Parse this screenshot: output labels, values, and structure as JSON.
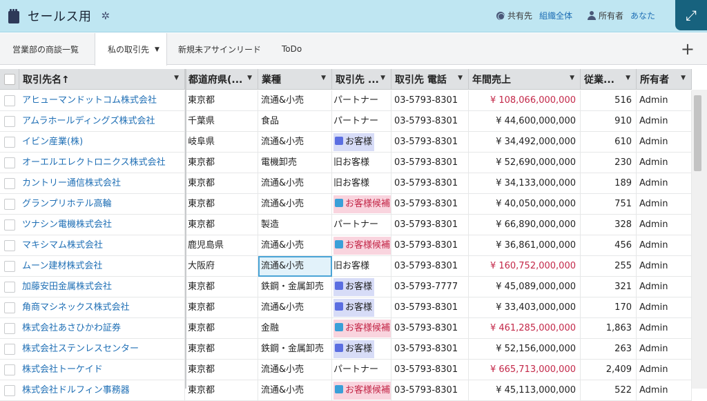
{
  "header": {
    "title": "セールス用",
    "shared_label": "共有先",
    "shared_value": "組織全体",
    "owner_label": "所有者",
    "owner_value": "あなた",
    "colors": {
      "bg": "#bfe6f2",
      "accent": "#17627e",
      "link": "#1f6fb5"
    }
  },
  "icons": {
    "sheet": "document-icon",
    "gear": "gear-icon",
    "globe": "globe-icon",
    "user": "user-icon",
    "expand": "expand-icon",
    "add": "plus-icon"
  },
  "tabs": [
    {
      "label": "営業部の商談一覧",
      "active": false
    },
    {
      "label": "私の取引先",
      "active": true
    },
    {
      "label": "新規未アサインリード",
      "active": false
    },
    {
      "label": "ToDo",
      "active": false
    }
  ],
  "columns": [
    "取引先名↑",
    "都道府県(...",
    "業種",
    "取引先 ...",
    "取引先 電話",
    "年間売上",
    "従業...",
    "所有者"
  ],
  "rows": [
    {
      "name": "アヒューマンドットコム株式会社",
      "pref": "東京都",
      "industry": "流通&小売",
      "type": "パートナー",
      "type_badge": "",
      "phone": "03-5793-8301",
      "revenue": "¥ 108,066,000,000",
      "rev_red": true,
      "emp": "516",
      "owner": "Admin"
    },
    {
      "name": "アムラホールディングズ株式会社",
      "pref": "千葉県",
      "industry": "食品",
      "type": "パートナー",
      "type_badge": "",
      "phone": "03-5793-8301",
      "revenue": "¥ 44,600,000,000",
      "rev_red": false,
      "emp": "910",
      "owner": "Admin"
    },
    {
      "name": "イビン産業(株)",
      "pref": "岐阜県",
      "industry": "流通&小売",
      "type": "お客様",
      "type_badge": "customer",
      "phone": "03-5793-8301",
      "revenue": "¥ 34,492,000,000",
      "rev_red": false,
      "emp": "610",
      "owner": "Admin"
    },
    {
      "name": "オーエルエレクトロニクス株式会社",
      "pref": "東京都",
      "industry": "電機卸売",
      "type": "旧お客様",
      "type_badge": "",
      "phone": "03-5793-8301",
      "revenue": "¥ 52,690,000,000",
      "rev_red": false,
      "emp": "230",
      "owner": "Admin"
    },
    {
      "name": "カントリー通信株式会社",
      "pref": "東京都",
      "industry": "流通&小売",
      "type": "旧お客様",
      "type_badge": "",
      "phone": "03-5793-8301",
      "revenue": "¥ 34,133,000,000",
      "rev_red": false,
      "emp": "189",
      "owner": "Admin"
    },
    {
      "name": "グランプリホテル高輪",
      "pref": "東京都",
      "industry": "流通&小売",
      "type": "お客様候補",
      "type_badge": "prospect",
      "phone": "03-5793-8301",
      "revenue": "¥ 40,050,000,000",
      "rev_red": false,
      "emp": "751",
      "owner": "Admin"
    },
    {
      "name": "ツナシン電機株式会社",
      "pref": "東京都",
      "industry": "製造",
      "type": "パートナー",
      "type_badge": "",
      "phone": "03-5793-8301",
      "revenue": "¥ 66,890,000,000",
      "rev_red": false,
      "emp": "328",
      "owner": "Admin"
    },
    {
      "name": "マキシマム株式会社",
      "pref": "鹿児島県",
      "industry": "流通&小売",
      "type": "お客様候補",
      "type_badge": "prospect",
      "phone": "03-5793-8301",
      "revenue": "¥ 36,861,000,000",
      "rev_red": false,
      "emp": "456",
      "owner": "Admin"
    },
    {
      "name": "ムーン建材株式会社",
      "pref": "大阪府",
      "industry": "流通&小売",
      "type": "旧お客様",
      "type_badge": "",
      "phone": "03-5793-8301",
      "revenue": "¥ 160,752,000,000",
      "rev_red": true,
      "emp": "255",
      "owner": "Admin",
      "selected_industry": true
    },
    {
      "name": "加藤安田金属株式会社",
      "pref": "東京都",
      "industry": "鉄鋼・金属卸売",
      "type": "お客様",
      "type_badge": "customer",
      "phone": "03-5793-7777",
      "revenue": "¥ 45,089,000,000",
      "rev_red": false,
      "emp": "321",
      "owner": "Admin"
    },
    {
      "name": "角商マシネックス株式会社",
      "pref": "東京都",
      "industry": "流通&小売",
      "type": "お客様",
      "type_badge": "customer",
      "phone": "03-5793-8301",
      "revenue": "¥ 33,403,000,000",
      "rev_red": false,
      "emp": "170",
      "owner": "Admin"
    },
    {
      "name": "株式会社あさひかわ証券",
      "pref": "東京都",
      "industry": "金融",
      "type": "お客様候補",
      "type_badge": "prospect",
      "phone": "03-5793-8301",
      "revenue": "¥ 461,285,000,000",
      "rev_red": true,
      "emp": "1,863",
      "owner": "Admin"
    },
    {
      "name": "株式会社ステンレスセンター",
      "pref": "東京都",
      "industry": "鉄鋼・金属卸売",
      "type": "お客様",
      "type_badge": "customer",
      "phone": "03-5793-8301",
      "revenue": "¥ 52,156,000,000",
      "rev_red": false,
      "emp": "263",
      "owner": "Admin"
    },
    {
      "name": "株式会社トーケイド",
      "pref": "東京都",
      "industry": "流通&小売",
      "type": "パートナー",
      "type_badge": "",
      "phone": "03-5793-8301",
      "revenue": "¥ 665,713,000,000",
      "rev_red": true,
      "emp": "2,409",
      "owner": "Admin"
    },
    {
      "name": "株式会社ドルフィン事務器",
      "pref": "東京都",
      "industry": "流通&小売",
      "type": "お客様候補",
      "type_badge": "prospect",
      "phone": "03-5793-8301",
      "revenue": "¥ 45,113,000,000",
      "rev_red": false,
      "emp": "522",
      "owner": "Admin"
    }
  ]
}
